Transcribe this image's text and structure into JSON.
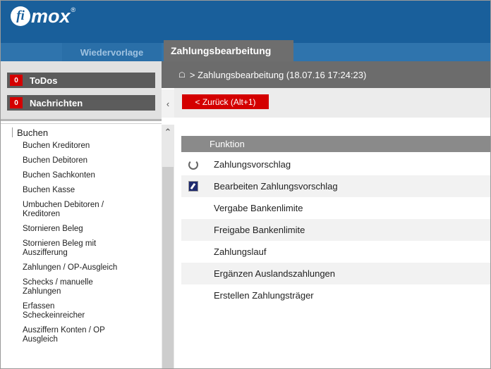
{
  "brand": {
    "logo_mark": "fi",
    "logo_text": "mox",
    "logo_reg": "®"
  },
  "tabs": [
    {
      "label": "Wiedervorlage",
      "active": false
    },
    {
      "label": "Zahlungsbearbeitung",
      "active": true
    }
  ],
  "left_buttons": [
    {
      "badge": "0",
      "label": "ToDos"
    },
    {
      "badge": "0",
      "label": "Nachrichten"
    }
  ],
  "tree": {
    "section": "Buchen",
    "items": [
      "Buchen Kreditoren",
      "Buchen Debitoren",
      "Buchen Sachkonten",
      "Buchen Kasse",
      "Umbuchen Debitoren / Kreditoren",
      "Stornieren Beleg",
      "Stornieren Beleg mit Auszifferung",
      "Zahlungen / OP-Ausgleich",
      "Schecks / manuelle Zahlungen",
      "Erfassen Scheckeinreicher",
      "Ausziffern Konten / OP Ausgleich"
    ]
  },
  "icons": {
    "home": "home-icon",
    "collapse": "chevron-left-icon",
    "scroll_up": "chevron-up-icon"
  },
  "breadcrumb": {
    "text": "> Zahlungsbearbeitung (18.07.16 17:24:23)"
  },
  "toolbar": {
    "back_label": "< Zurück (Alt+1)"
  },
  "table": {
    "header": "Funktion",
    "rows": [
      {
        "label": "Zahlungsvorschlag",
        "icon": "refresh-icon"
      },
      {
        "label": "Bearbeiten Zahlungsvorschlag",
        "icon": "edit-icon"
      },
      {
        "label": "Vergabe Bankenlimite",
        "icon": ""
      },
      {
        "label": "Freigabe Bankenlimite",
        "icon": ""
      },
      {
        "label": "Zahlungslauf",
        "icon": ""
      },
      {
        "label": "Ergänzen Auslandszahlungen",
        "icon": ""
      },
      {
        "label": "Erstellen Zahlungsträger",
        "icon": ""
      }
    ]
  },
  "colors": {
    "brand_blue": "#195f9b",
    "accent_red": "#d40000",
    "header_gray": "#6c6c6c"
  }
}
